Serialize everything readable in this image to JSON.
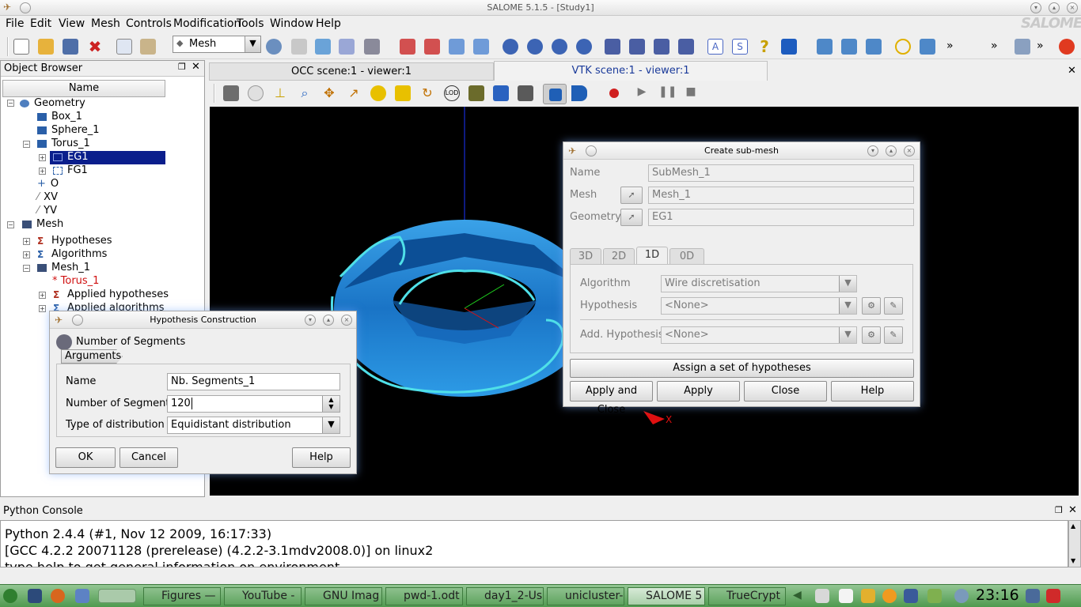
{
  "window": {
    "title": "SALOME 5.1.5 - [Study1]",
    "logo": "SALOME 5"
  },
  "menu": [
    "File",
    "Edit",
    "View",
    "Mesh",
    "Controls",
    "Modification",
    "Tools",
    "Window",
    "Help"
  ],
  "toolbar": {
    "module_combo": "Mesh",
    "overflow": "»"
  },
  "object_browser": {
    "title": "Object Browser",
    "column_header": "Name",
    "geometry": {
      "label": "Geometry",
      "children": [
        "Box_1",
        "Sphere_1",
        "Torus_1"
      ],
      "torus_children": [
        "EG1",
        "FG1"
      ],
      "extra": [
        "O",
        "XV",
        "YV"
      ]
    },
    "mesh": {
      "label": "Mesh",
      "children": [
        "Hypotheses",
        "Algorithms",
        "Mesh_1"
      ],
      "mesh1_children": [
        "* Torus_1",
        "Applied hypotheses",
        "Applied algorithms"
      ]
    }
  },
  "viewer_tabs": {
    "occ": "OCC scene:1 - viewer:1",
    "vtk": "VTK scene:1 - viewer:1"
  },
  "axis_label": "X",
  "submesh_dialog": {
    "title": "Create sub-mesh",
    "name_label": "Name",
    "name_value": "SubMesh_1",
    "mesh_label": "Mesh",
    "mesh_value": "Mesh_1",
    "geometry_label": "Geometry",
    "geometry_value": "EG1",
    "tabs": [
      "3D",
      "2D",
      "1D",
      "0D"
    ],
    "algorithm_label": "Algorithm",
    "algorithm_value": "Wire discretisation",
    "hypothesis_label": "Hypothesis",
    "hypothesis_value": "<None>",
    "add_hypothesis_label": "Add. Hypothesis",
    "add_hypothesis_value": "<None>",
    "assign_button": "Assign a set of hypotheses",
    "apply_close_button": "Apply and Close",
    "apply_button": "Apply",
    "close_button": "Close",
    "help_button": "Help"
  },
  "hypothesis_dialog": {
    "title": "Hypothesis Construction",
    "heading": "Number of Segments",
    "group": "Arguments",
    "name_label": "Name",
    "name_value": "Nb. Segments_1",
    "segments_label": "Number of Segments",
    "segments_value": "120",
    "distribution_label": "Type of distribution",
    "distribution_value": "Equidistant distribution",
    "ok_button": "OK",
    "cancel_button": "Cancel",
    "help_button": "Help"
  },
  "python_console": {
    "title": "Python Console",
    "lines": [
      "Python 2.4.4 (#1, Nov 12 2009, 16:17:33)",
      "[GCC 4.2.2 20071128 (prerelease) (4.2.2-3.1mdv2008.0)] on linux2",
      "type help to get general information on environment"
    ]
  },
  "taskbar": {
    "tasks": [
      "Figures —",
      "YouTube - ",
      "GNU Imag",
      "pwd-1.odt",
      "day1_2-Us",
      "unicluster-",
      "SALOME 5",
      "TrueCrypt"
    ],
    "clock": "23:16"
  }
}
